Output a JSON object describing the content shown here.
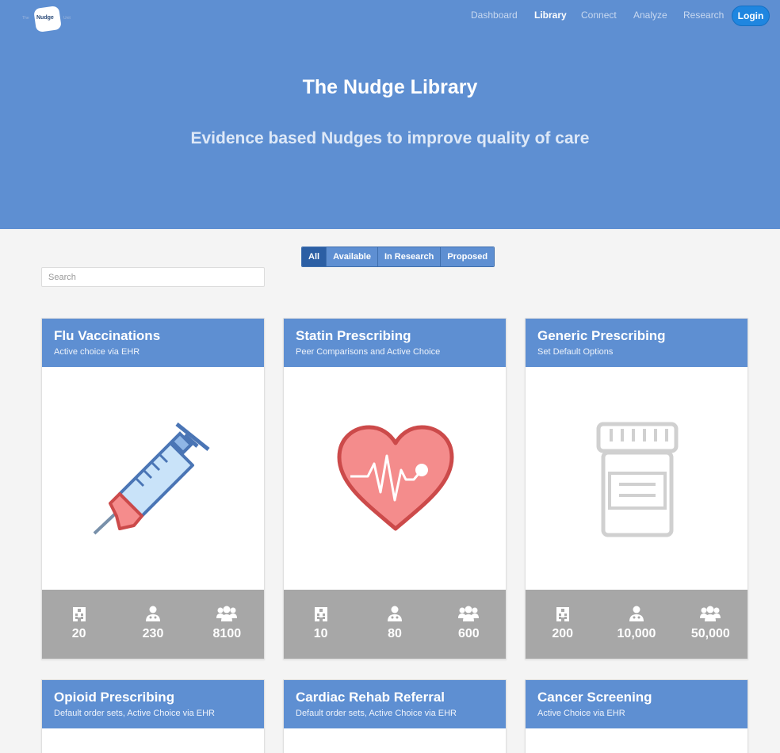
{
  "app": {
    "logo_text": "Nudge",
    "logo_left_text": "The",
    "logo_right_text": "Unit"
  },
  "nav": {
    "items": [
      {
        "label": "Dashboard",
        "active": false
      },
      {
        "label": "Library",
        "active": true
      },
      {
        "label": "Connect",
        "active": false
      },
      {
        "label": "Analyze",
        "active": false
      },
      {
        "label": "Research",
        "active": false
      }
    ],
    "login_label": "Login"
  },
  "hero": {
    "title": "The Nudge Library",
    "subtitle": "Evidence based Nudges to improve quality of care"
  },
  "filters": {
    "options": [
      "All",
      "Available",
      "In Research",
      "Proposed"
    ],
    "selected": "All"
  },
  "search": {
    "placeholder": "Search",
    "value": ""
  },
  "cards": [
    {
      "title": "Flu Vaccinations",
      "subtitle": "Active choice via EHR",
      "icon": "syringe-icon",
      "stats": {
        "hospitals": "20",
        "clinicians": "230",
        "patients": "8100"
      }
    },
    {
      "title": "Statin Prescribing",
      "subtitle": "Peer Comparisons and Active Choice",
      "icon": "heart-pulse-icon",
      "stats": {
        "hospitals": "10",
        "clinicians": "80",
        "patients": "600"
      }
    },
    {
      "title": "Generic Prescribing",
      "subtitle": "Set Default Options",
      "icon": "pill-bottle-icon",
      "stats": {
        "hospitals": "200",
        "clinicians": "10,000",
        "patients": "50,000"
      }
    },
    {
      "title": "Opioid Prescribing",
      "subtitle": "Default order sets, Active Choice via EHR"
    },
    {
      "title": "Cardiac Rehab Referral",
      "subtitle": "Default order sets, Active Choice via EHR"
    },
    {
      "title": "Cancer Screening",
      "subtitle": "Active Choice via EHR"
    }
  ],
  "colors": {
    "primary": "#5e8fd2",
    "login": "#1f86e0",
    "stats_bar": "#a7a7a7",
    "background": "#f4f4f4"
  }
}
